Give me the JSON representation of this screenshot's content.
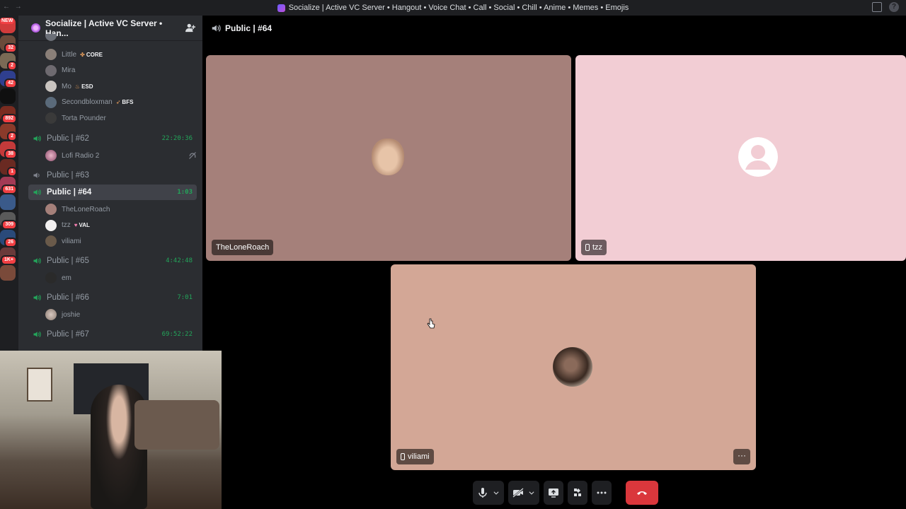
{
  "window": {
    "title": "Socialize | Active VC Server • Hangout • Voice Chat • Call • Social • Chill • Anime • Memes • Emojis"
  },
  "guilds": [
    {
      "badge": "NEW",
      "color": "#d13b3b"
    },
    {
      "badge": "32",
      "color": "#6b4a3a"
    },
    {
      "badge": "2",
      "color": "#7a6a55"
    },
    {
      "badge": "42",
      "color": "#2f3f8f"
    },
    {
      "badge": "",
      "color": "#101010"
    },
    {
      "badge": "892",
      "color": "#7a2c20"
    },
    {
      "badge": "2",
      "color": "#8a3a2a"
    },
    {
      "badge": "38",
      "color": "#c43a3a"
    },
    {
      "badge": "1",
      "color": "#6a2a22"
    },
    {
      "badge": "631",
      "color": "#a33a55"
    },
    {
      "badge": "",
      "color": "#3a5a8a"
    },
    {
      "badge": "309",
      "color": "#5a5a5a"
    },
    {
      "badge": "26",
      "color": "#2a4a7a"
    },
    {
      "badge": "1K+",
      "color": "#6a3a3a"
    },
    {
      "badge": "",
      "color": "#7a4a3a"
    }
  ],
  "server": {
    "name": "Socialize | Active VC Server • Han..."
  },
  "channels": {
    "members_top": [
      {
        "name": "Little",
        "tag": "CORE",
        "tag_glyph": "✤"
      },
      {
        "name": "Mira",
        "tag": ""
      },
      {
        "name": "Mo",
        "tag": "ESD",
        "tag_glyph": "♨"
      },
      {
        "name": "Secondbloxman",
        "tag": "BFS",
        "tag_glyph": "➶"
      },
      {
        "name": "Torta Pounder",
        "tag": ""
      }
    ],
    "vc62": {
      "name": "Public | #62",
      "timer": "22:20:36",
      "member": "Lofi Radio 2"
    },
    "vc63": {
      "name": "Public | #63"
    },
    "vc64": {
      "name": "Public | #64",
      "timer": "1:03",
      "members": [
        {
          "name": "TheLoneRoach",
          "tag": ""
        },
        {
          "name": "tzz",
          "tag": "VAL",
          "tag_glyph": "♥"
        },
        {
          "name": "viliami",
          "tag": ""
        }
      ]
    },
    "vc65": {
      "name": "Public | #65",
      "timer": "4:42:48",
      "member": "em"
    },
    "vc66": {
      "name": "Public | #66",
      "timer": "7:01",
      "member": "joshie"
    },
    "vc67": {
      "name": "Public | #67",
      "timer": "69:52:22"
    }
  },
  "call": {
    "channel_title": "Public | #64",
    "tiles": [
      {
        "name": "TheLoneRoach",
        "bg": "#a5807a",
        "mobile": false
      },
      {
        "name": "tzz",
        "bg": "#f2cdd4",
        "mobile": true
      },
      {
        "name": "viliami",
        "bg": "#d3a796",
        "mobile": true
      }
    ],
    "more_label": "···"
  },
  "colors": {
    "speaker_active": "#23a55a",
    "speaker_idle": "#80848e",
    "leave": "#da373c"
  }
}
